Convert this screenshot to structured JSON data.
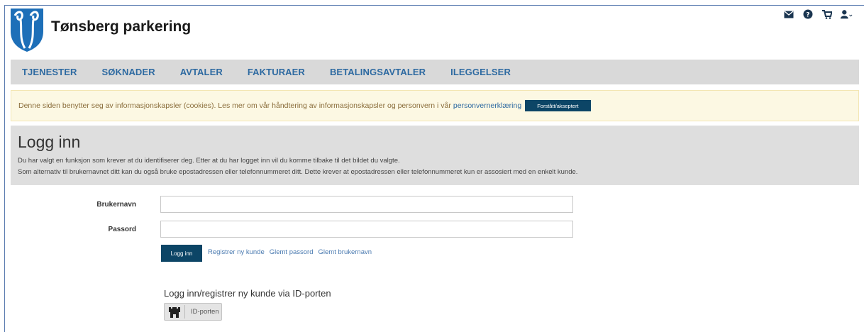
{
  "header": {
    "brand": "Tønsberg parkering",
    "icons": [
      "envelope-icon",
      "help-icon",
      "cart-icon",
      "user-menu-icon"
    ]
  },
  "nav": {
    "items": [
      "TJENESTER",
      "SØKNADER",
      "AVTALER",
      "FAKTURAER",
      "BETALINGSAVTALER",
      "ILEGGELSER"
    ]
  },
  "cookie": {
    "text": "Denne siden benytter seg av informasjonskapsler (cookies). Les mer om vår håndtering av informasjonskapsler og personvern i vår",
    "link": "personvernerklæring",
    "button": "Forstått/akseptert"
  },
  "login_panel": {
    "title": "Logg inn",
    "line1": "Du har valgt en funksjon som krever at du identifiserer deg. Etter at du har logget inn vil du komme tilbake til det bildet du valgte.",
    "line2": "Som alternativ til brukernavnet ditt kan du også bruke epostadressen eller telefonnummeret ditt. Dette krever at epostadressen eller telefonnummeret kun er assosiert med en enkelt kunde."
  },
  "form": {
    "username_label": "Brukernavn",
    "username_value": "",
    "password_label": "Passord",
    "password_value": "",
    "login_button": "Logg inn",
    "links": [
      "Registrer ny kunde",
      "Glemt passord",
      "Glemt brukernavn"
    ]
  },
  "id_porten": {
    "heading": "Logg inn/registrer ny kunde via ID-porten",
    "button": "ID-porten"
  },
  "colors": {
    "nav_link": "#2e6aa1",
    "primary_button": "#0c4566",
    "cookie_bg": "#fcf8e3",
    "panel_bg": "#dedede"
  }
}
